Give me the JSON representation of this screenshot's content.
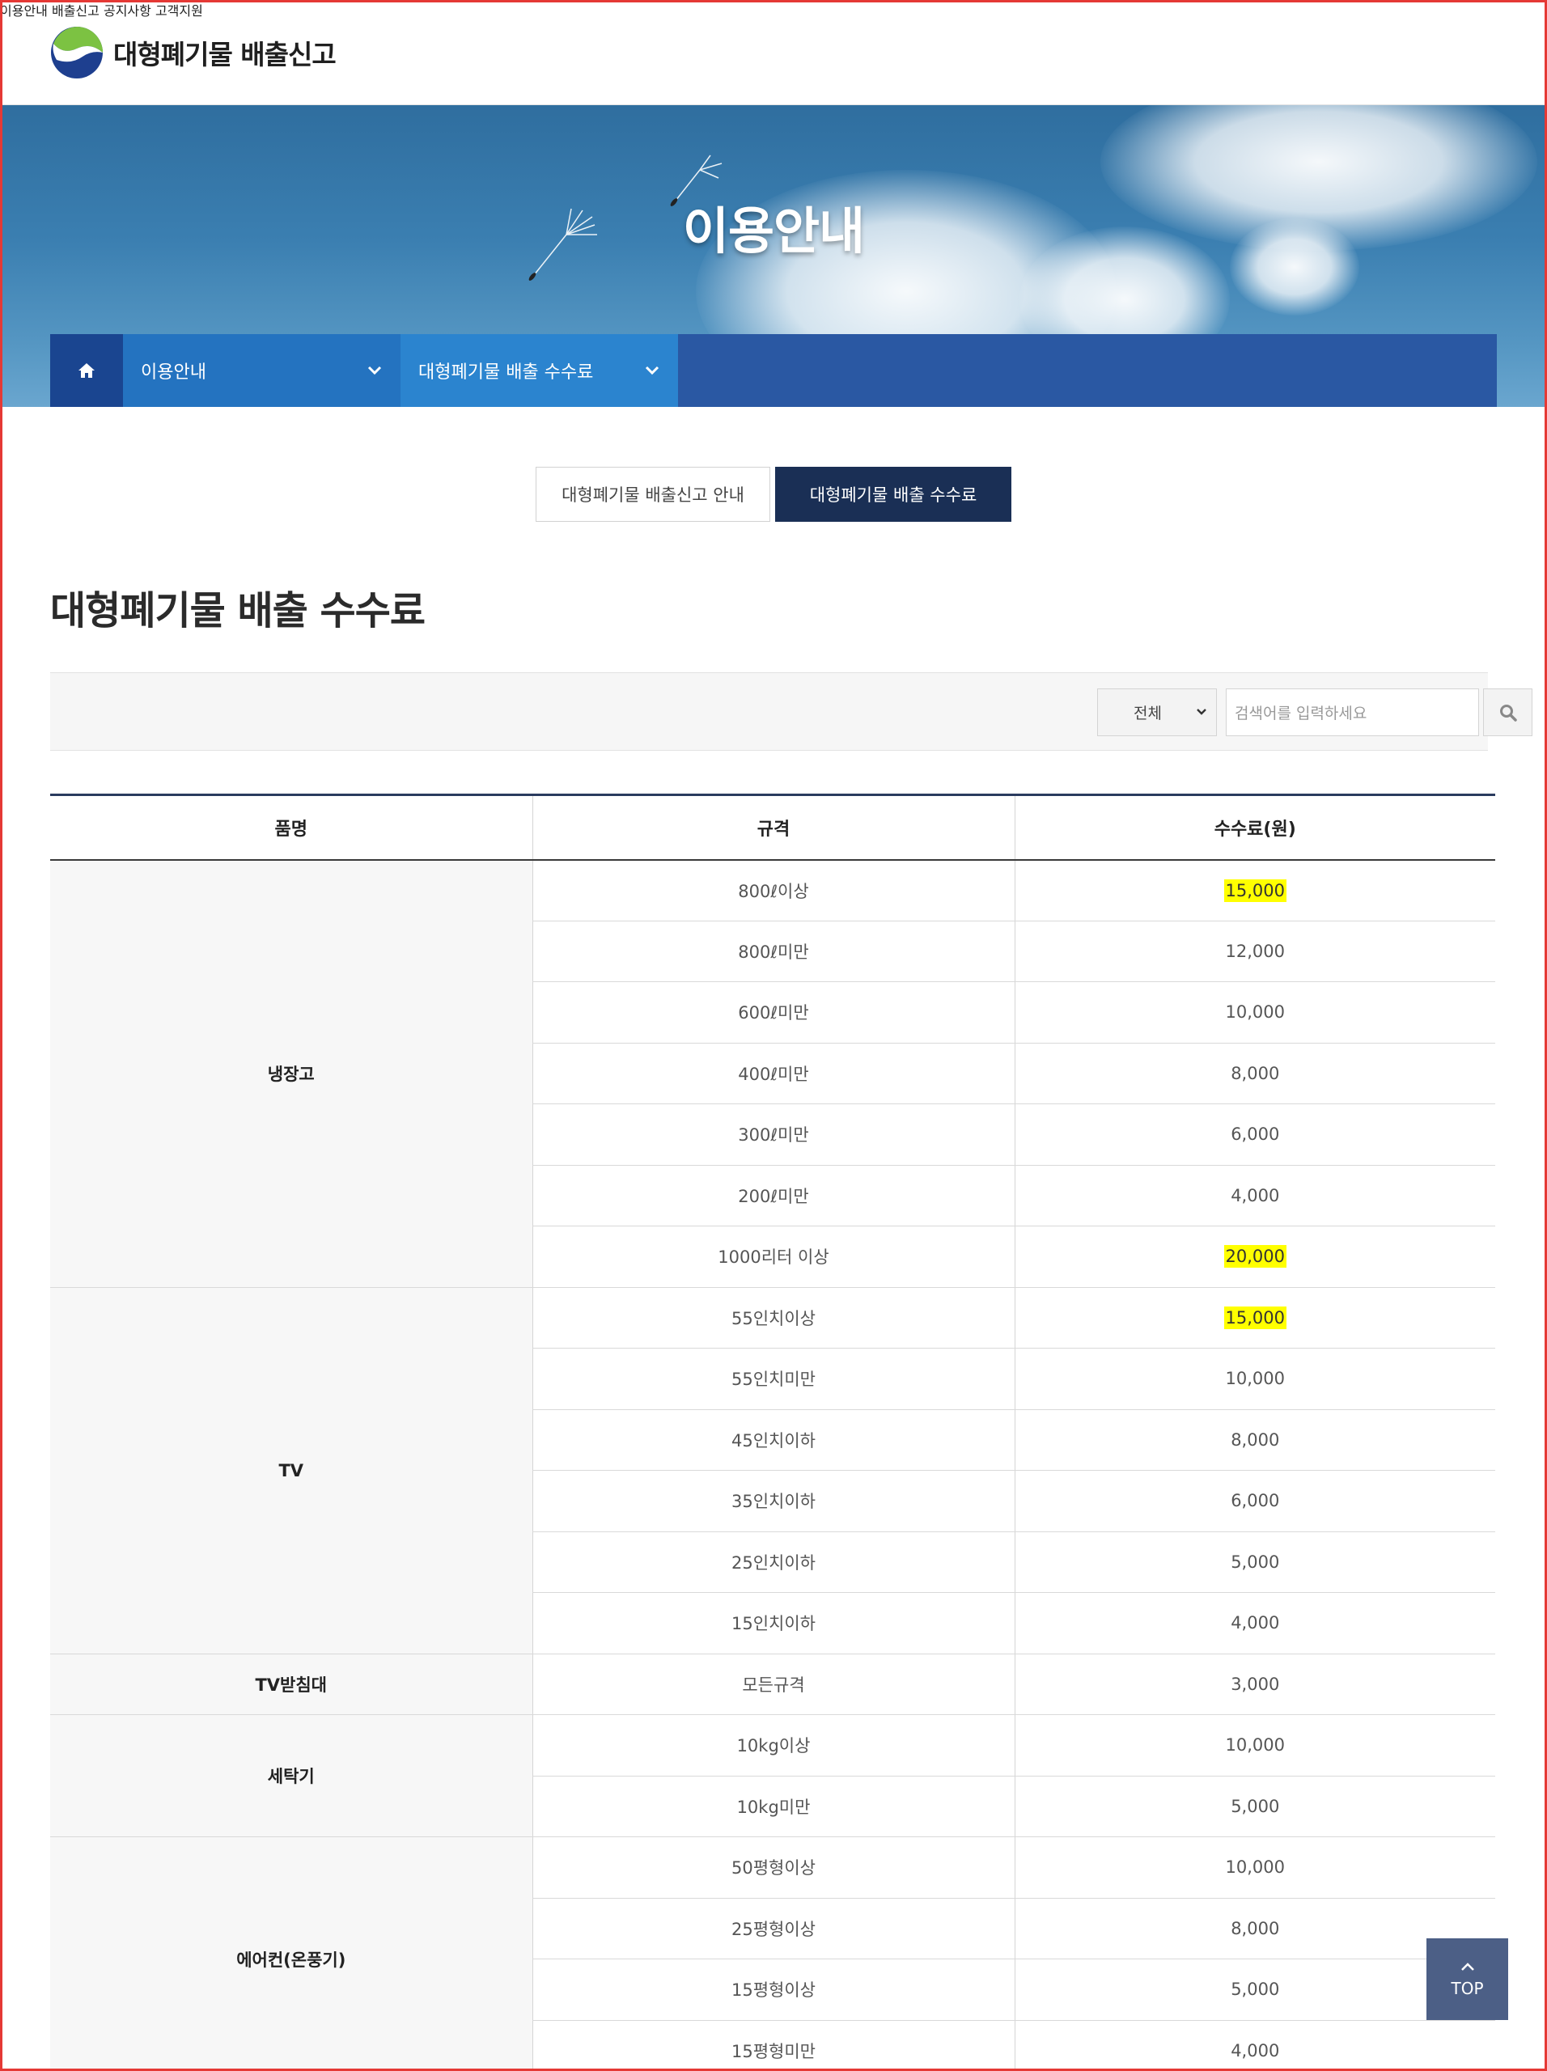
{
  "site": {
    "logo_text": "대형폐기물 배출신고"
  },
  "nav": [
    "이용안내",
    "배출신고",
    "공지사항",
    "고객지원"
  ],
  "hero": {
    "title": "이용안내"
  },
  "breadcrumb": {
    "level1": "이용안내",
    "level2": "대형폐기물 배출 수수료"
  },
  "tabs": [
    {
      "label": "대형폐기물 배출신고 안내",
      "active": false
    },
    {
      "label": "대형폐기물 배출 수수료",
      "active": true
    }
  ],
  "page_title": "대형폐기물 배출 수수료",
  "search": {
    "select_value": "전체",
    "placeholder": "검색어를 입력하세요"
  },
  "table": {
    "headers": [
      "품명",
      "규격",
      "수수료(원)"
    ],
    "groups": [
      {
        "item": "냉장고",
        "rows": [
          {
            "spec": "800ℓ이상",
            "fee": "15,000",
            "highlight": true
          },
          {
            "spec": "800ℓ미만",
            "fee": "12,000"
          },
          {
            "spec": "600ℓ미만",
            "fee": "10,000"
          },
          {
            "spec": "400ℓ미만",
            "fee": "8,000"
          },
          {
            "spec": "300ℓ미만",
            "fee": "6,000"
          },
          {
            "spec": "200ℓ미만",
            "fee": "4,000"
          },
          {
            "spec": "1000리터 이상",
            "fee": "20,000",
            "highlight": true
          }
        ]
      },
      {
        "item": "TV",
        "rows": [
          {
            "spec": "55인치이상",
            "fee": "15,000",
            "highlight": true
          },
          {
            "spec": "55인치미만",
            "fee": "10,000"
          },
          {
            "spec": "45인치이하",
            "fee": "8,000"
          },
          {
            "spec": "35인치이하",
            "fee": "6,000"
          },
          {
            "spec": "25인치이하",
            "fee": "5,000"
          },
          {
            "spec": "15인치이하",
            "fee": "4,000"
          }
        ]
      },
      {
        "item": "TV받침대",
        "rows": [
          {
            "spec": "모든규격",
            "fee": "3,000"
          }
        ]
      },
      {
        "item": "세탁기",
        "rows": [
          {
            "spec": "10kg이상",
            "fee": "10,000"
          },
          {
            "spec": "10kg미만",
            "fee": "5,000"
          }
        ]
      },
      {
        "item": "에어컨(온풍기)",
        "rows": [
          {
            "spec": "50평형이상",
            "fee": "10,000"
          },
          {
            "spec": "25평형이상",
            "fee": "8,000"
          },
          {
            "spec": "15평형이상",
            "fee": "5,000"
          },
          {
            "spec": "15평형미만",
            "fee": "4,000"
          }
        ]
      }
    ]
  },
  "top_button": {
    "label": "TOP"
  },
  "colors": {
    "header_dark": "#1a2f55",
    "crumb_blue": "#2a58a3",
    "highlight": "#ffff00",
    "top_button": "#4c5f86"
  },
  "icons": [
    "logo-mark-icon",
    "home-icon",
    "chevron-down-icon",
    "search-icon",
    "chevron-up-icon"
  ]
}
